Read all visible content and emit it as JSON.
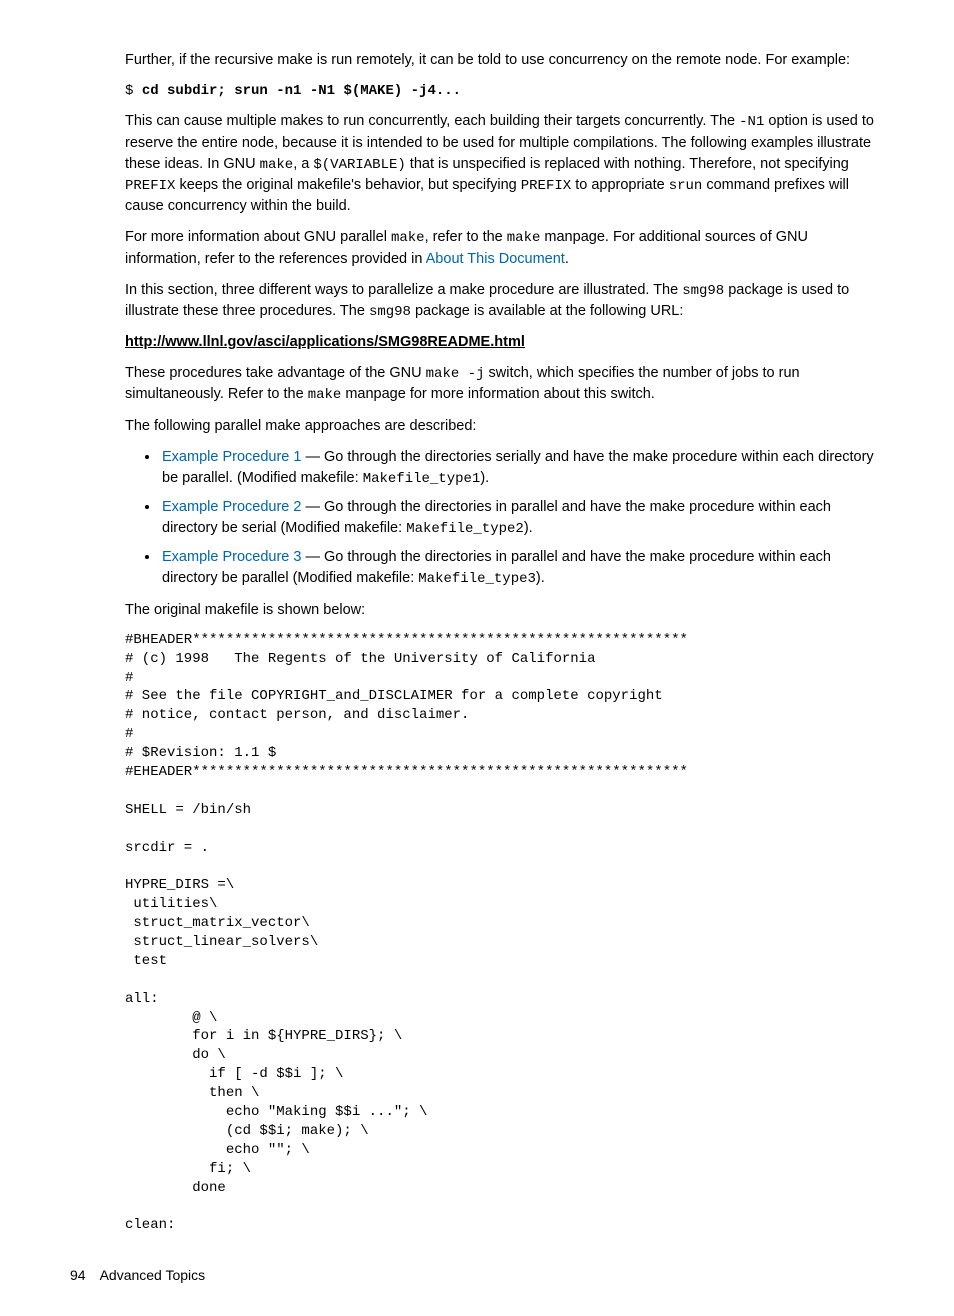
{
  "para1": "Further, if the recursive make is run remotely, it can be told to use concurrency on the remote node. For example:",
  "cmd": {
    "prompt": "$ ",
    "text": "cd subdir; srun -n1 -N1 $(MAKE) -j4..."
  },
  "para2a": "This can cause multiple makes to run concurrently, each building their targets concurrently. The ",
  "code_N1": "-N1",
  "para2b": " option is used to reserve the entire node, because it is intended to be used for multiple compilations. The following examples illustrate these ideas. In GNU ",
  "code_make": "make",
  "para2c": ", a ",
  "code_var": "$(VARIABLE)",
  "para2d": " that is unspecified is replaced with nothing. Therefore, not specifying ",
  "code_prefix": "PREFIX",
  "para2e": " keeps the original makefile's behavior, but specifying ",
  "para2f": " to appropriate ",
  "code_srun": "srun",
  "para2g": " command prefixes will cause concurrency within the build.",
  "para3a": "For more information about GNU parallel ",
  "para3b": ", refer to the ",
  "para3c": " manpage. For additional sources of GNU information, refer to the references provided in ",
  "link_about": "About This Document",
  "para3d": ".",
  "para4a": "In this section, three different ways to parallelize a make procedure are illustrated. The ",
  "code_smg": "smg98",
  "para4b": " package is used to illustrate these three procedures. The ",
  "para4c": " package is available at the following URL:",
  "url": "http://www.llnl.gov/asci/applications/SMG98README.html",
  "para5a": "These procedures take advantage of the GNU ",
  "code_makej": "make -j",
  "para5b": " switch, which specifies the number of jobs to run simultaneously. Refer to the ",
  "para5c": " manpage for more information about this switch.",
  "para6": "The following parallel make approaches are described:",
  "items": [
    {
      "link": "Example Procedure 1",
      "desc_a": " — Go through the directories serially and have the make procedure within each directory be parallel. (Modified makefile: ",
      "file": "Makefile_type1",
      "desc_b": ")."
    },
    {
      "link": "Example Procedure 2",
      "desc_a": " — Go through the directories in parallel and have the make procedure within each directory be serial (Modified makefile: ",
      "file": "Makefile_type2",
      "desc_b": ")."
    },
    {
      "link": "Example Procedure 3",
      "desc_a": " — Go through the directories in parallel and have the make procedure within each directory be parallel (Modified makefile: ",
      "file": "Makefile_type3",
      "desc_b": ")."
    }
  ],
  "para7": "The original makefile is shown below:",
  "code_block": "#BHEADER***********************************************************\n# (c) 1998   The Regents of the University of California\n#\n# See the file COPYRIGHT_and_DISCLAIMER for a complete copyright\n# notice, contact person, and disclaimer.\n#\n# $Revision: 1.1 $\n#EHEADER***********************************************************\n\nSHELL = /bin/sh\n\nsrcdir = .\n\nHYPRE_DIRS =\\\n utilities\\\n struct_matrix_vector\\\n struct_linear_solvers\\\n test\n\nall:\n        @ \\\n        for i in ${HYPRE_DIRS}; \\\n        do \\\n          if [ -d $$i ]; \\\n          then \\\n            echo \"Making $$i ...\"; \\\n            (cd $$i; make); \\\n            echo \"\"; \\\n          fi; \\\n        done\n\nclean:",
  "footer": {
    "page": "94",
    "section": "Advanced Topics"
  }
}
